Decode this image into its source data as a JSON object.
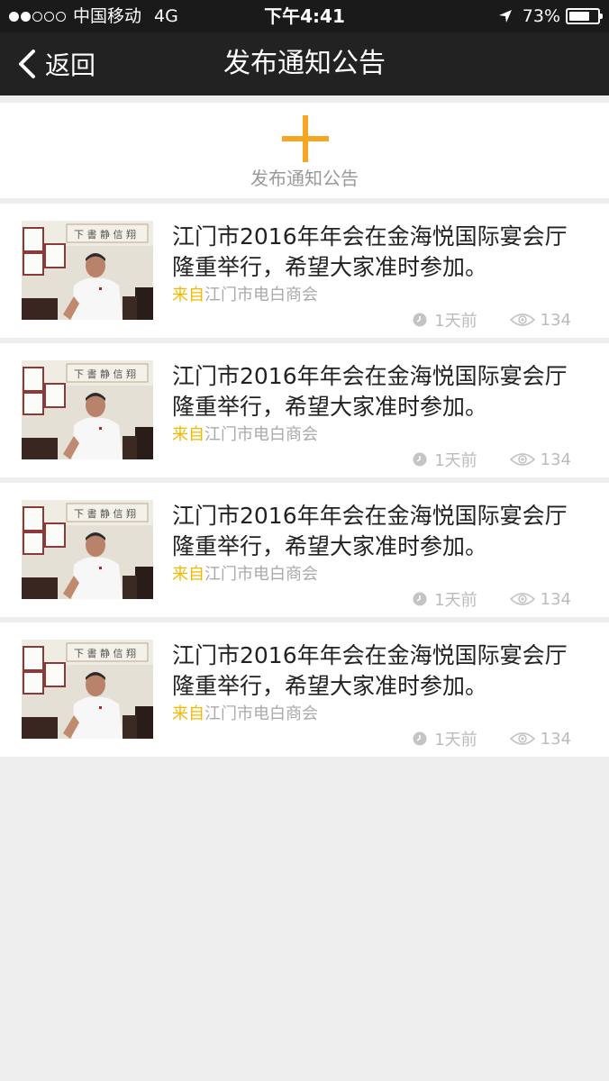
{
  "status_bar": {
    "carrier": "中国移动",
    "network": "4G",
    "time": "下午4:41",
    "battery": "73%",
    "battery_level": 0.73,
    "signal_strength": 2,
    "signal_max": 5
  },
  "nav": {
    "back_label": "返回",
    "title": "发布通知公告"
  },
  "publish": {
    "label": "发布通知公告",
    "accent_color": "#f5a623"
  },
  "notices": [
    {
      "title": "江门市2016年年会在金海悦国际宴会厅隆重举行，希望大家准时参加。",
      "source_prefix": "来自",
      "source": "江门市电白商会",
      "time_ago": "1天前",
      "views": "134"
    },
    {
      "title": "江门市2016年年会在金海悦国际宴会厅隆重举行，希望大家准时参加。",
      "source_prefix": "来自",
      "source": "江门市电白商会",
      "time_ago": "1天前",
      "views": "134"
    },
    {
      "title": "江门市2016年年会在金海悦国际宴会厅隆重举行，希望大家准时参加。",
      "source_prefix": "来自",
      "source": "江门市电白商会",
      "time_ago": "1天前",
      "views": "134"
    },
    {
      "title": "江门市2016年年会在金海悦国际宴会厅隆重举行，希望大家准时参加。",
      "source_prefix": "来自",
      "source": "江门市电白商会",
      "time_ago": "1天前",
      "views": "134"
    }
  ],
  "icons": {
    "back": "chevron-left-icon",
    "plus": "plus-icon",
    "clock": "clock-icon",
    "views": "eye-icon",
    "location": "location-arrow-icon"
  }
}
